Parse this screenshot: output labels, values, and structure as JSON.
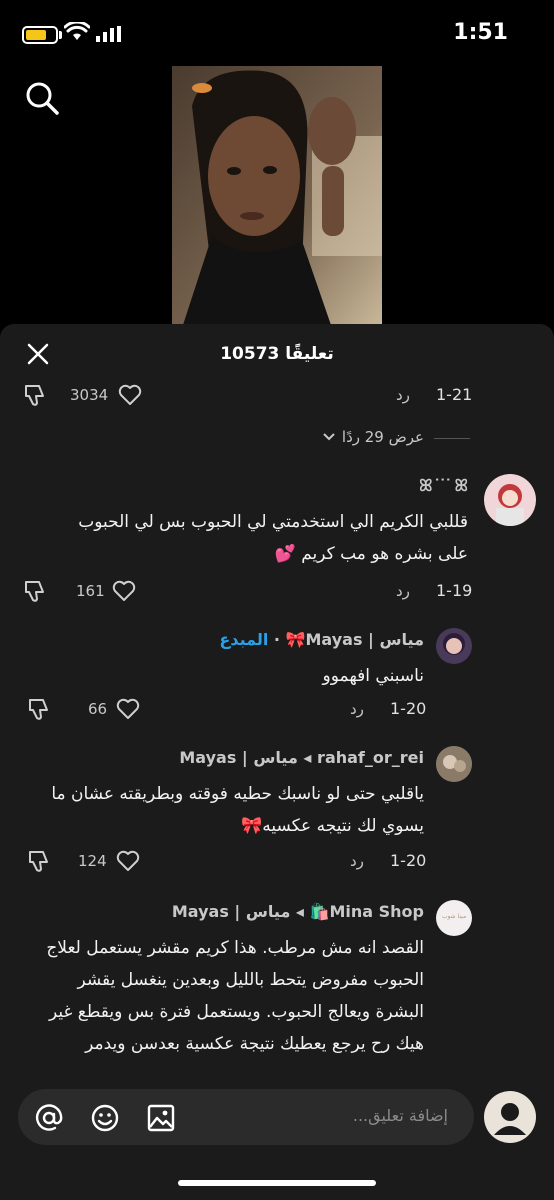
{
  "status": {
    "time": "1:51"
  },
  "panel": {
    "title": "10573 تعليقًا"
  },
  "top_row": {
    "likes": "3034",
    "reply": "رد",
    "date": "1-21"
  },
  "view_replies": "عرض 29 ردًا",
  "input": {
    "placeholder": "إضافة تعليق..."
  },
  "comments": [
    {
      "username": "ꕤ ͘ ͘  ͘ ꕤ",
      "text_lines": [
        "قللبي الكريم الي استخدمتي لي الحبوب بس لي الحبوب",
        "على بشره هو مب كريم 💕"
      ],
      "date": "1-19",
      "reply": "رد",
      "likes": "161"
    },
    {
      "username": "مياس | Mayas🎀",
      "badge": "المبدع",
      "text_lines": [
        "ناسبني افهموو"
      ],
      "date": "1-20",
      "reply": "رد",
      "likes": "66"
    },
    {
      "username": "rahaf_or_rei",
      "reply_to": "مياس | Mayas",
      "text_lines": [
        "ياقلبي حتى لو ناسبك حطيه فوقته وبطريقته عشان ما",
        "يسوي لك نتيجه عكسيه🎀"
      ],
      "date": "1-20",
      "reply": "رد",
      "likes": "124"
    },
    {
      "username": "Mina Shop🛍️",
      "reply_to": "مياس | Mayas",
      "avatar_text": "مينا شوب",
      "text_lines": [
        "القصد انه مش مرطب. هذا كريم مقشر يستعمل لعلاج",
        "الحبوب مفروض يتحط بالليل وبعدين ينغسل يقشر",
        "البشرة ويعالج الحبوب. ويستعمل فترة بس ويقطع غير",
        "هيك رح يرجع يعطيك نتيجة عكسية بعدسن ويدمر"
      ]
    }
  ],
  "colors": {
    "panel_bg": "#1b1b1b",
    "creator_badge": "#2aa0e6",
    "battery": "#f5c518"
  }
}
